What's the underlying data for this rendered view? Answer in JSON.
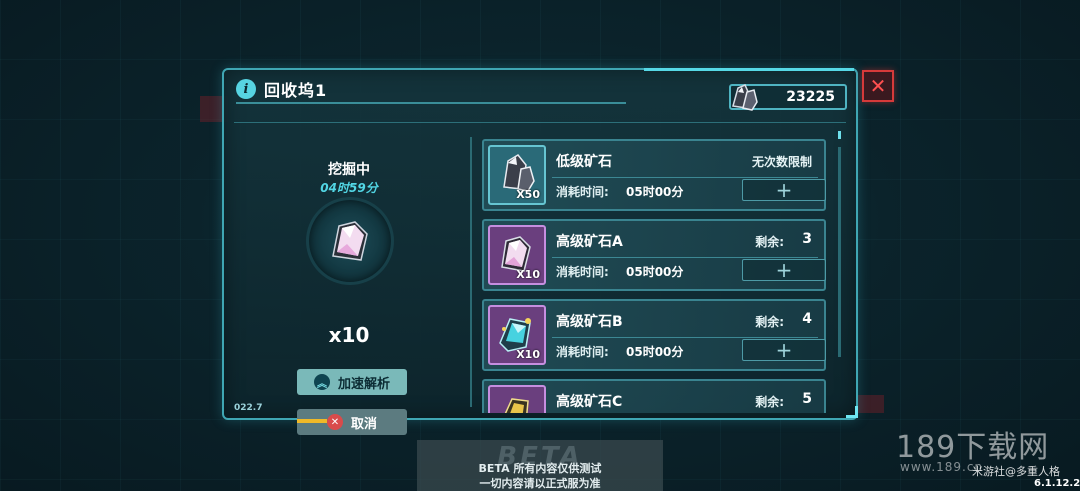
{
  "window": {
    "title": "回收坞1",
    "currency_value": "23225",
    "close_symbol": "✕"
  },
  "mining": {
    "status_label": "挖掘中",
    "timer": "04时59分",
    "count": "x10",
    "speed_button": "加速解析",
    "cancel_button": "取消"
  },
  "items": [
    {
      "name": "低级矿石",
      "qty": "X50",
      "limit_text": "无次数限制",
      "cost_label": "消耗时间:",
      "cost_value": "05时00分",
      "tier": "low"
    },
    {
      "name": "高级矿石A",
      "qty": "X10",
      "remain_label": "剩余:",
      "remain_value": "3",
      "cost_label": "消耗时间:",
      "cost_value": "05时00分",
      "tier": "high"
    },
    {
      "name": "高级矿石B",
      "qty": "X10",
      "remain_label": "剩余:",
      "remain_value": "4",
      "cost_label": "消耗时间:",
      "cost_value": "05时00分",
      "tier": "high"
    },
    {
      "name": "高级矿石C",
      "remain_label": "剩余:",
      "remain_value": "5",
      "tier": "high"
    }
  ],
  "add_symbol": "+",
  "footer": {
    "version_left": "022.7",
    "beta_big": "BETA",
    "beta_line1": "BETA  所有内容仅供测试",
    "beta_line2": "一切内容请以正式服为准",
    "version_right": "6.1.12.2"
  },
  "watermark": {
    "main": "189下载网",
    "sub": "www.189.cn",
    "tag": "米游社@多重人格"
  },
  "colors": {
    "accent": "#52d6e4",
    "panel_border": "#3fa6b3",
    "close_red": "#d63a3a",
    "tier_low": "#2a6a78",
    "tier_high": "#6a3f7e",
    "speed_button": "#7ab9b9",
    "cancel_button": "#5c7b80"
  },
  "icons": {
    "info": "info-icon",
    "currency": "crystal-cluster-icon",
    "close": "close-icon",
    "ore": "pink-crystal-icon",
    "speed": "double-chevron-up-icon",
    "cancel": "cancel-x-icon",
    "add": "plus-icon"
  }
}
